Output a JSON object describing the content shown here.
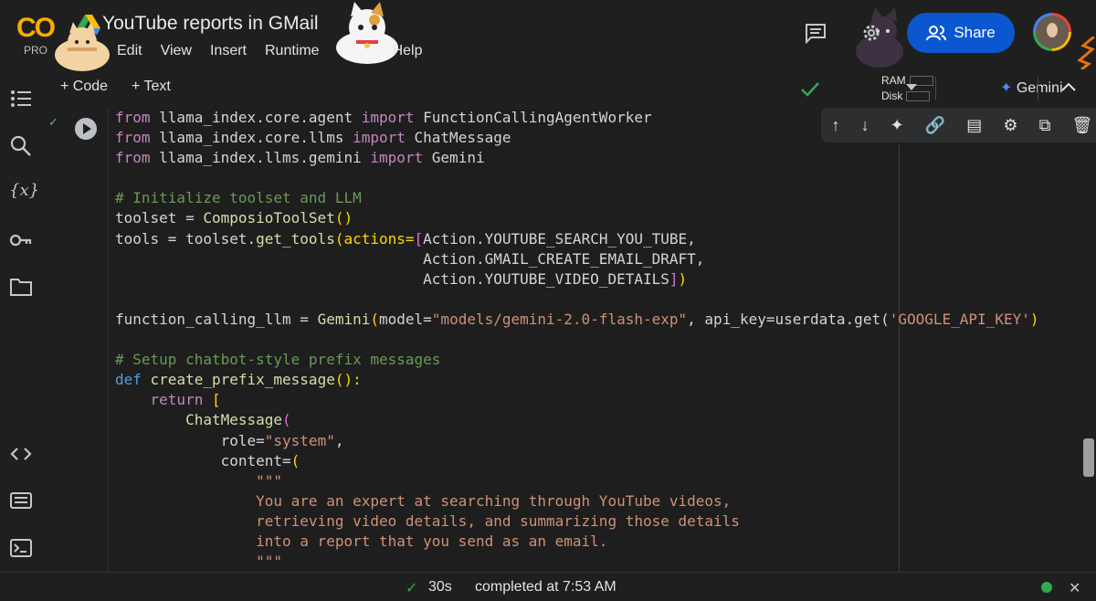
{
  "app": {
    "logo": "CO",
    "logo_sub": "PRO",
    "title": "YouTube reports in GMail"
  },
  "menu": [
    "Edit",
    "View",
    "Insert",
    "Runtime",
    "Help"
  ],
  "share_label": "Share",
  "toolbar": {
    "add_code": "+ Code",
    "add_text": "+ Text",
    "ram": "RAM",
    "disk": "Disk",
    "gemini": "Gemini"
  },
  "status": {
    "duration": "30s",
    "completed": "completed at 7:53 AM"
  },
  "icons": {
    "sidebar": [
      "toc-icon",
      "search-icon",
      "variables-icon",
      "key-icon",
      "folder-icon",
      "code-snippets-icon",
      "command-palette-icon",
      "terminal-icon"
    ],
    "cell_tools": [
      "arrow-up-icon",
      "arrow-down-icon",
      "gemini-sparkle-icon",
      "link-icon",
      "comment-icon",
      "gear-icon",
      "mirror-cell-icon",
      "trash-icon",
      "more-vert-icon"
    ]
  },
  "colors": {
    "accent": "#0b57d0",
    "success": "#34a853",
    "keyword": "#569cd6",
    "comment": "#6a9955",
    "string": "#ce9178"
  },
  "code": {
    "l1a": "from",
    "l1b": " llama_index.core.agent ",
    "l1c": "import",
    "l1d": " FunctionCallingAgentWorker",
    "l2a": "from",
    "l2b": " llama_index.core.llms ",
    "l2c": "import",
    "l2d": " ChatMessage",
    "l3a": "from",
    "l3b": " llama_index.llms.gemini ",
    "l3c": "import",
    "l3d": " Gemini",
    "l5": "# Initialize toolset and LLM",
    "l6a": "toolset = ",
    "l6b": "ComposioToolSet",
    "l6c": "()",
    "l7a": "tools = toolset.",
    "l7b": "get_tools",
    "l7c": "(actions=",
    "l7d": "[",
    "l7e": "Action.YOUTUBE_SEARCH_YOU_TUBE,",
    "l8": "                                   Action.GMAIL_CREATE_EMAIL_DRAFT,",
    "l9a": "                                   Action.YOUTUBE_VIDEO_DETAILS",
    "l9b": "]",
    "l9c": ")",
    "l11a": "function_calling_llm = ",
    "l11b": "Gemini",
    "l11c": "(",
    "l11d": "model=",
    "l11e": "\"models/gemini-2.0-flash-exp\"",
    "l11f": ", api_key=userdata.get(",
    "l11g": "'GOOGLE_API_KEY'",
    "l11h": ")",
    "l13": "# Setup chatbot-style prefix messages",
    "l14a": "def",
    "l14b": " create_prefix_message",
    "l14c": "():",
    "l15a": "    ",
    "l15b": "return",
    "l15c": " [",
    "l16a": "        ",
    "l16b": "ChatMessage",
    "l16c": "(",
    "l17a": "            role=",
    "l17b": "\"system\"",
    "l17c": ",",
    "l18a": "            content=",
    "l18b": "(",
    "l19": "                \"\"\"",
    "l20": "                You are an expert at searching through YouTube videos,",
    "l21": "                retrieving video details, and summarizing those details",
    "l22": "                into a report that you send as an email.",
    "l23": "                \"\"\""
  }
}
